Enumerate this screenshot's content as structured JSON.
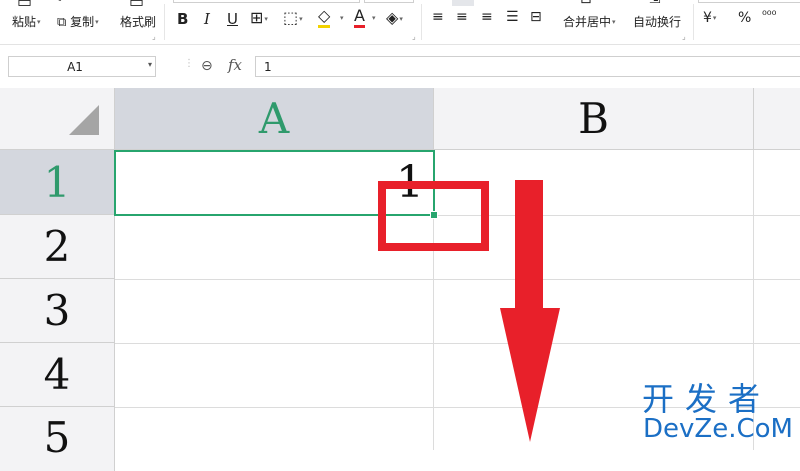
{
  "ribbon": {
    "paste_label": "粘贴",
    "copy_label": "复制",
    "format_painter_label": "格式刷",
    "bold_icon": "B",
    "italic_icon": "I",
    "underline_icon": "U",
    "merge_center_label": "合并居中",
    "wrap_text_label": "自动换行",
    "currency_icon": "¥",
    "percent_icon": "%",
    "thousands_icon": "⁰⁰⁰"
  },
  "formula_bar": {
    "name_box_value": "A1",
    "fx_label": "fx",
    "formula_value": "1"
  },
  "sheet": {
    "columns": [
      "A",
      "B"
    ],
    "rows": [
      "1",
      "2",
      "3",
      "4",
      "5"
    ],
    "cell_a1_value": "1",
    "selected_cell": "A1"
  },
  "watermark": {
    "line1": "开发者",
    "line2": "DevZe.CoM"
  },
  "colors": {
    "selection": "#27a56e",
    "annotation": "#e8202a",
    "watermark": "#1b6fc5"
  }
}
